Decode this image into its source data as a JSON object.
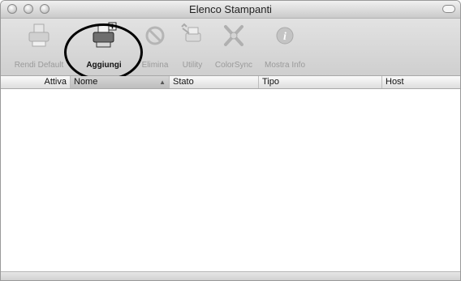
{
  "window": {
    "title": "Elenco Stampanti"
  },
  "toolbar": {
    "items": [
      {
        "label": "Rendi Default",
        "icon": "printer-default-icon",
        "enabled": false
      },
      {
        "label": "Aggiungi",
        "icon": "add-printer-icon",
        "enabled": true
      },
      {
        "label": "Elimina",
        "icon": "delete-icon",
        "enabled": false
      },
      {
        "label": "Utility",
        "icon": "utility-icon",
        "enabled": false
      },
      {
        "label": "ColorSync",
        "icon": "colorsync-icon",
        "enabled": false
      },
      {
        "label": "Mostra Info",
        "icon": "info-icon",
        "enabled": false
      }
    ]
  },
  "table": {
    "columns": [
      "Attiva",
      "Nome",
      "Stato",
      "Tipo",
      "Host"
    ],
    "sorted_column": "Nome",
    "rows": []
  }
}
